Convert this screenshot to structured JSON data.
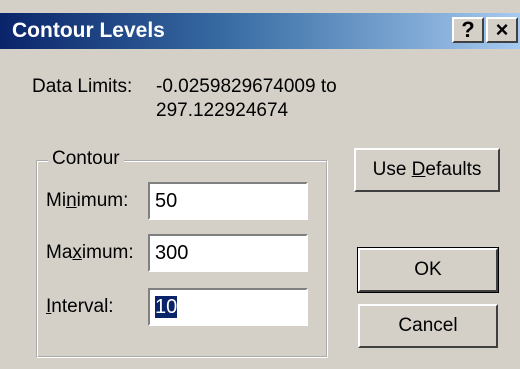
{
  "window": {
    "title": "Contour Levels",
    "help_button": "?",
    "close_button": "×"
  },
  "data_limits": {
    "label": "Data Limits:",
    "line1": "-0.0259829674009 to",
    "line2": "297.122924674"
  },
  "contour": {
    "group_label": "Contour",
    "minimum": {
      "label_pre": "Mi",
      "label_u": "n",
      "label_post": "imum:",
      "value": "50"
    },
    "maximum": {
      "label_pre": "Ma",
      "label_u": "x",
      "label_post": "imum:",
      "value": "300"
    },
    "interval": {
      "label_pre": "",
      "label_u": "I",
      "label_post": "nterval:",
      "value": "10"
    }
  },
  "buttons": {
    "use_defaults_pre": "Use ",
    "use_defaults_u": "D",
    "use_defaults_post": "efaults",
    "ok": "OK",
    "cancel": "Cancel"
  }
}
